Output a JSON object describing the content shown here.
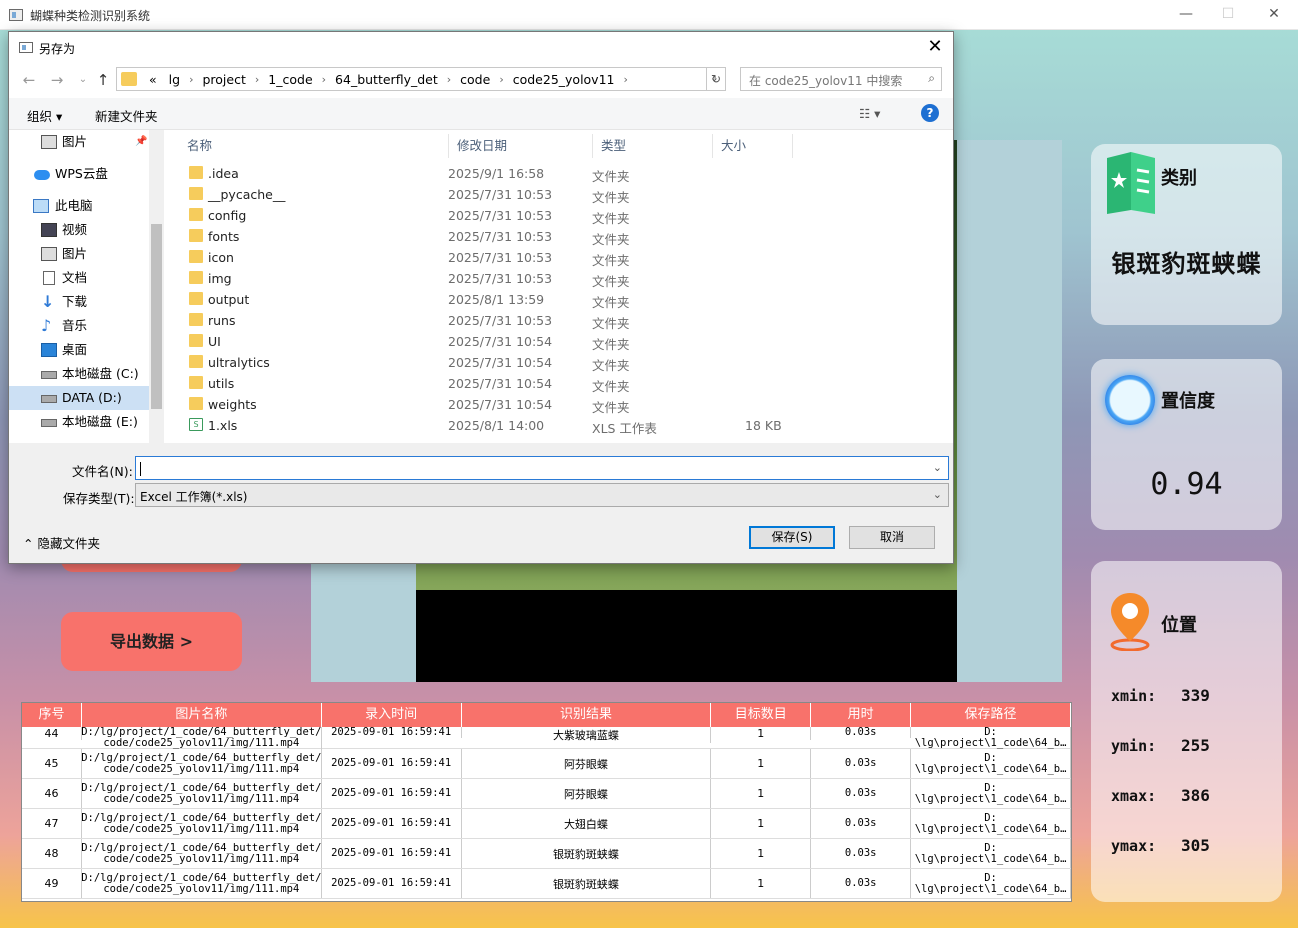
{
  "window": {
    "title": "蝴蝶种类检测识别系统"
  },
  "cards": {
    "class": {
      "label": "类别",
      "value": "银斑豹斑蛱蝶"
    },
    "confidence": {
      "label": "置信度",
      "value": "0.94"
    },
    "position": {
      "label": "位置",
      "xmin_label": "xmin:",
      "xmin": "339",
      "ymin_label": "ymin:",
      "ymin": "255",
      "xmax_label": "xmax:",
      "xmax": "386",
      "ymax_label": "ymax:",
      "ymax": "305"
    }
  },
  "export_button": "导出数据 >",
  "table": {
    "headers": [
      "序号",
      "图片名称",
      "录入时间",
      "识别结果",
      "目标数目",
      "用时",
      "保存路径"
    ],
    "rows": [
      {
        "id": "44",
        "name1": "D:/lg/project/1_code/64_butterfly_det/",
        "name2": "code/code25_yolov11/img/111.mp4",
        "time": "2025-09-01 16:59:41",
        "result": "大紫玻璃蓝蝶",
        "count": "1",
        "dur": "0.03s",
        "path1": "D:",
        "path2": "\\lg\\project\\1_code\\64_b…"
      },
      {
        "id": "45",
        "name1": "D:/lg/project/1_code/64_butterfly_det/",
        "name2": "code/code25_yolov11/img/111.mp4",
        "time": "2025-09-01 16:59:41",
        "result": "阿芬眼蝶",
        "count": "1",
        "dur": "0.03s",
        "path1": "D:",
        "path2": "\\lg\\project\\1_code\\64_b…"
      },
      {
        "id": "46",
        "name1": "D:/lg/project/1_code/64_butterfly_det/",
        "name2": "code/code25_yolov11/img/111.mp4",
        "time": "2025-09-01 16:59:41",
        "result": "阿芬眼蝶",
        "count": "1",
        "dur": "0.03s",
        "path1": "D:",
        "path2": "\\lg\\project\\1_code\\64_b…"
      },
      {
        "id": "47",
        "name1": "D:/lg/project/1_code/64_butterfly_det/",
        "name2": "code/code25_yolov11/img/111.mp4",
        "time": "2025-09-01 16:59:41",
        "result": "大翅白蝶",
        "count": "1",
        "dur": "0.03s",
        "path1": "D:",
        "path2": "\\lg\\project\\1_code\\64_b…"
      },
      {
        "id": "48",
        "name1": "D:/lg/project/1_code/64_butterfly_det/",
        "name2": "code/code25_yolov11/img/111.mp4",
        "time": "2025-09-01 16:59:41",
        "result": "银斑豹斑蛱蝶",
        "count": "1",
        "dur": "0.03s",
        "path1": "D:",
        "path2": "\\lg\\project\\1_code\\64_b…"
      },
      {
        "id": "49",
        "name1": "D:/lg/project/1_code/64_butterfly_det/",
        "name2": "code/code25_yolov11/img/111.mp4",
        "time": "2025-09-01 16:59:41",
        "result": "银斑豹斑蛱蝶",
        "count": "1",
        "dur": "0.03s",
        "path1": "D:",
        "path2": "\\lg\\project\\1_code\\64_b…"
      }
    ]
  },
  "dialog": {
    "title": "另存为",
    "breadcrumbs": [
      "«",
      "lg",
      "project",
      "1_code",
      "64_butterfly_det",
      "code",
      "code25_yolov11"
    ],
    "search_placeholder": "在 code25_yolov11 中搜索",
    "organize": "组织 ▾",
    "new_folder": "新建文件夹",
    "sidebar": [
      "图片",
      "WPS云盘",
      "此电脑",
      "视频",
      "图片",
      "文档",
      "下载",
      "音乐",
      "桌面",
      "本地磁盘 (C:)",
      "DATA (D:)",
      "本地磁盘 (E:)"
    ],
    "columns": [
      "名称",
      "修改日期",
      "类型",
      "大小"
    ],
    "files": [
      {
        "name": ".idea",
        "date": "2025/9/1 16:58",
        "type": "文件夹",
        "size": ""
      },
      {
        "name": "__pycache__",
        "date": "2025/7/31 10:53",
        "type": "文件夹",
        "size": ""
      },
      {
        "name": "config",
        "date": "2025/7/31 10:53",
        "type": "文件夹",
        "size": ""
      },
      {
        "name": "fonts",
        "date": "2025/7/31 10:53",
        "type": "文件夹",
        "size": ""
      },
      {
        "name": "icon",
        "date": "2025/7/31 10:53",
        "type": "文件夹",
        "size": ""
      },
      {
        "name": "img",
        "date": "2025/7/31 10:53",
        "type": "文件夹",
        "size": ""
      },
      {
        "name": "output",
        "date": "2025/8/1 13:59",
        "type": "文件夹",
        "size": ""
      },
      {
        "name": "runs",
        "date": "2025/7/31 10:53",
        "type": "文件夹",
        "size": ""
      },
      {
        "name": "UI",
        "date": "2025/7/31 10:54",
        "type": "文件夹",
        "size": ""
      },
      {
        "name": "ultralytics",
        "date": "2025/7/31 10:54",
        "type": "文件夹",
        "size": ""
      },
      {
        "name": "utils",
        "date": "2025/7/31 10:54",
        "type": "文件夹",
        "size": ""
      },
      {
        "name": "weights",
        "date": "2025/7/31 10:54",
        "type": "文件夹",
        "size": ""
      },
      {
        "name": "1.xls",
        "date": "2025/8/1 14:00",
        "type": "XLS 工作表",
        "size": "18 KB"
      }
    ],
    "filename_label": "文件名(N):",
    "filename_value": "",
    "filetype_label": "保存类型(T):",
    "filetype_value": "Excel 工作簿(*.xls)",
    "hide_folders": "隐藏文件夹",
    "save": "保存(S)",
    "cancel": "取消"
  }
}
